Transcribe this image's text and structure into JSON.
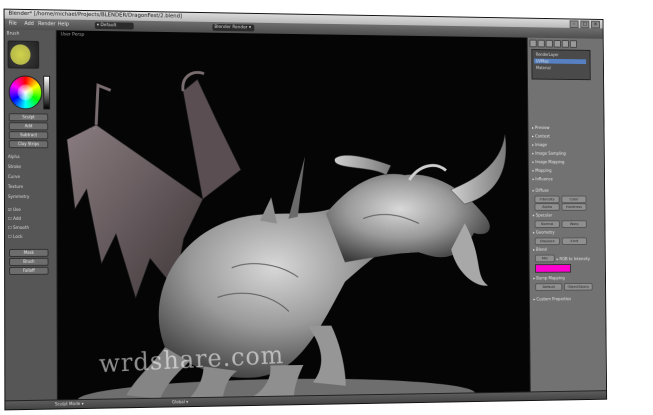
{
  "window": {
    "title": "Blender* [/home/michael/Projects/BLENDER/DragonFest/2.blend]"
  },
  "menubar": {
    "items": [
      "File",
      "Add",
      "Render",
      "Help"
    ],
    "scene_field": "Default",
    "render_engine": "Blender Render"
  },
  "left_panel": {
    "header": "Brush",
    "buttons": [
      "Sculpt",
      "Add",
      "Subtract",
      "Clay Strips"
    ],
    "sections": [
      "Alpha",
      "Stroke",
      "Curve",
      "Texture",
      "Symmetry"
    ],
    "checkbox_labels": [
      "Use",
      "Add",
      "Smooth",
      "Lock"
    ],
    "extra_buttons": [
      "Mask",
      "Brush",
      "Falloff"
    ]
  },
  "viewport": {
    "label": "User Persp"
  },
  "watermark": {
    "text": "wrdshare.com"
  },
  "right_panel": {
    "layers": [
      "RenderLayer",
      "UVMap",
      "Material"
    ],
    "sections": [
      "Preview",
      "Context",
      "Image",
      "Image Sampling",
      "Image Mapping",
      "Mapping",
      "Influence",
      "Diffuse",
      "Specular",
      "Geometry",
      "Blend",
      "Custom Properties"
    ],
    "influence_values": [
      "Intensity",
      "Color",
      "Alpha",
      "Hardness",
      "Normal",
      "Warp",
      "Displace",
      "Emit"
    ],
    "blend_mode": "Mix",
    "color_label": "RGB to Intensity",
    "magenta_color": "#ff00d0",
    "bump_label": "Bump Mapping",
    "method": "Default",
    "space": "ObjectSpace"
  },
  "statusbar": {
    "mode": "Sculpt Mode",
    "global": "Global"
  }
}
